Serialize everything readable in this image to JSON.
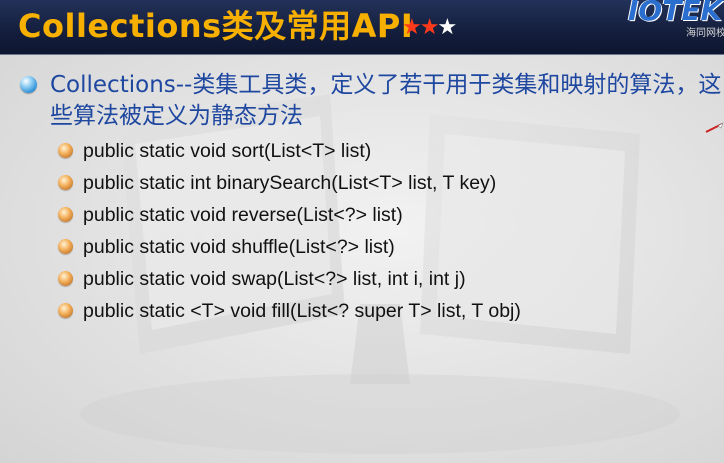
{
  "title_bar": {
    "title": "Collections类及常用API",
    "stars_filled": "★★",
    "stars_empty": "★",
    "rating": {
      "filled": 2,
      "total": 3
    }
  },
  "logo": {
    "text": "IOTEK",
    "subtitle": "海同网校"
  },
  "content": {
    "main_point": "Collections--类集工具类，定义了若干用于类集和映射的算法，这些算法被定义为静态方法",
    "methods": [
      "public static void sort(List<T> list)",
      "public static int binarySearch(List<T> list, T key)",
      "public static void reverse(List<?> list)",
      "public static void shuffle(List<?> list)",
      "public static void swap(List<?> list, int i, int j)",
      "public static <T> void fill(List<? super T> list,  T obj)"
    ]
  },
  "colors": {
    "title": "#f7b000",
    "title_bar_bg": "#141e3c",
    "main_text": "#1e47a0",
    "body_text": "#111111",
    "star_red": "#ff3a1a"
  }
}
